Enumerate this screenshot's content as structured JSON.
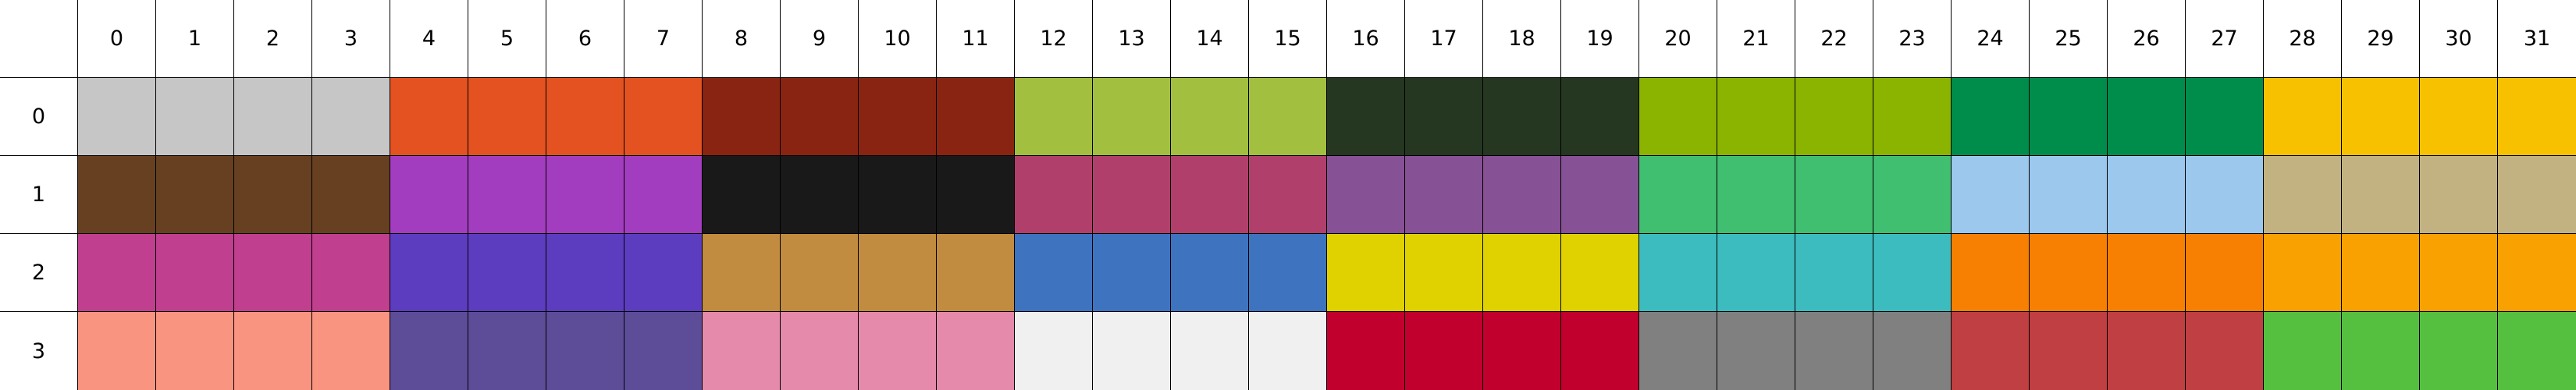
{
  "columns": [
    "0",
    "1",
    "2",
    "3",
    "4",
    "5",
    "6",
    "7",
    "8",
    "9",
    "10",
    "11",
    "12",
    "13",
    "14",
    "15",
    "16",
    "17",
    "18",
    "19",
    "20",
    "21",
    "22",
    "23",
    "24",
    "25",
    "26",
    "27",
    "28",
    "29",
    "30",
    "31"
  ],
  "rows": [
    {
      "label": "0",
      "colors": [
        "#c6c6c6",
        "#e35220",
        "#8a2412",
        "#a2bf3f",
        "#253621",
        "#8bb400",
        "#008d4c",
        "#f8c100"
      ]
    },
    {
      "label": "1",
      "colors": [
        "#664020",
        "#a33dbf",
        "#191919",
        "#b13f6c",
        "#865195",
        "#40bf71",
        "#9dc8ee",
        "#c2b281"
      ]
    },
    {
      "label": "2",
      "colors": [
        "#c03f8f",
        "#5d3dbf",
        "#c18c3f",
        "#3e73c0",
        "#dfd200",
        "#3dbcbf",
        "#f78002",
        "#f9a100"
      ]
    },
    {
      "label": "3",
      "colors": [
        "#f99480",
        "#5d4c98",
        "#e68aab",
        "#f0f0f0",
        "#c1002e",
        "#808080",
        "#c03f42",
        "#55bf40"
      ]
    }
  ]
}
